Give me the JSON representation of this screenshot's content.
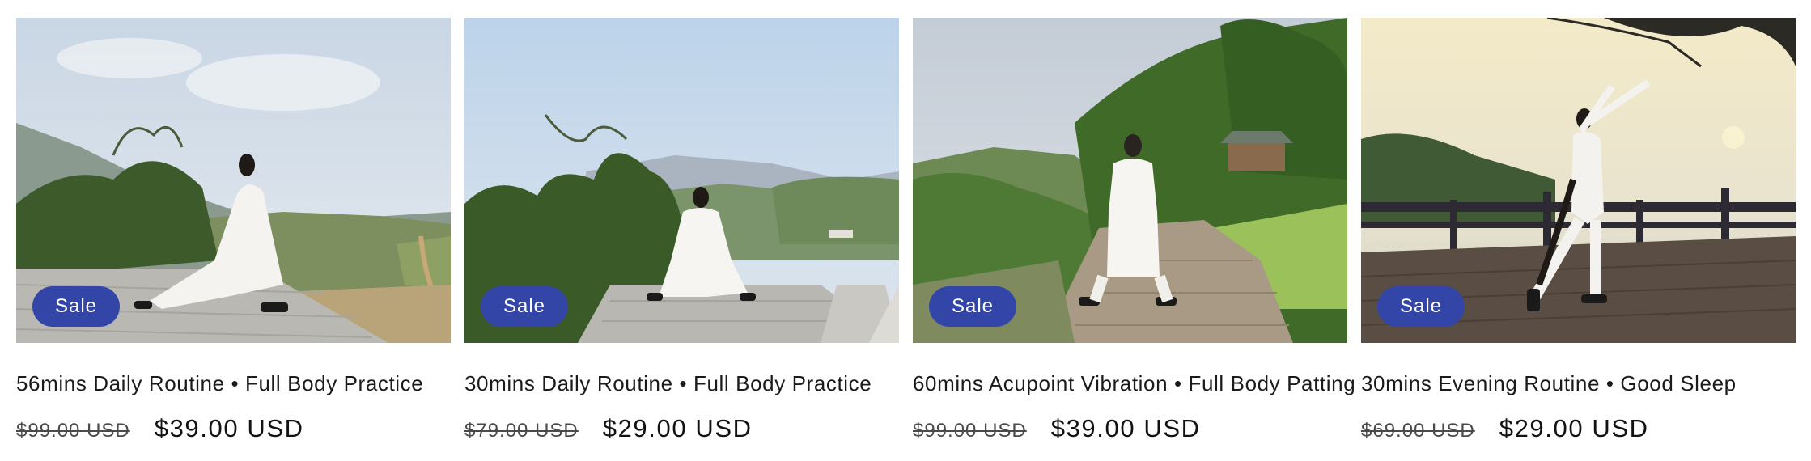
{
  "products": [
    {
      "badge": "Sale",
      "title": "56mins Daily Routine • Full Body Practice",
      "compare_price": "$99.00 USD",
      "price": "$39.00 USD"
    },
    {
      "badge": "Sale",
      "title": "30mins Daily Routine • Full Body Practice",
      "compare_price": "$79.00 USD",
      "price": "$29.00 USD"
    },
    {
      "badge": "Sale",
      "title": "60mins Acupoint Vibration • Full Body Patting",
      "compare_price": "$99.00 USD",
      "price": "$39.00 USD"
    },
    {
      "badge": "Sale",
      "title": "30mins Evening Routine • Good Sleep",
      "compare_price": "$69.00 USD",
      "price": "$29.00 USD"
    }
  ],
  "colors": {
    "badge_bg": "#3346a8",
    "badge_text": "#ffffff",
    "text": "#121212"
  }
}
